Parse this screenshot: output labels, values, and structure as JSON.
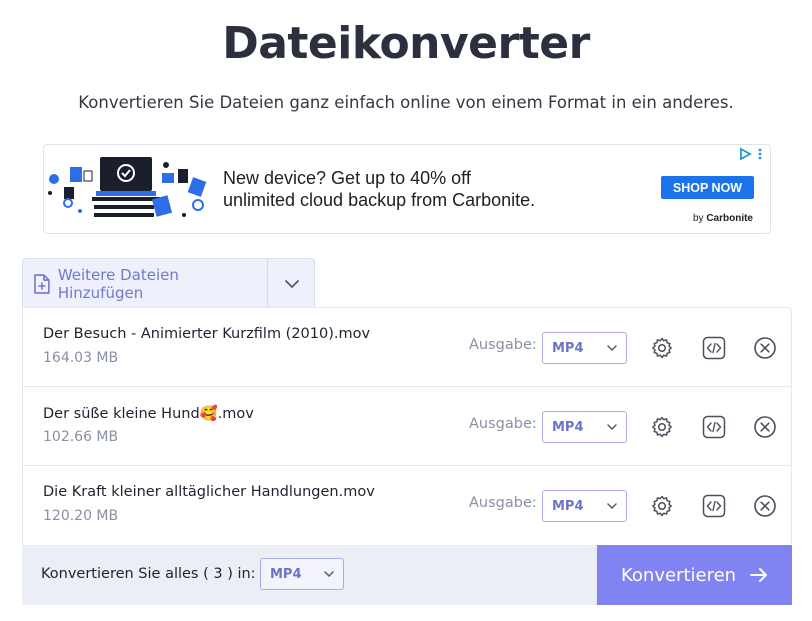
{
  "header": {
    "title": "Dateikonverter",
    "subtitle": "Konvertieren Sie Dateien ganz einfach online von einem Format in ein anderes."
  },
  "ad": {
    "line1": "New device? Get up to 40% off",
    "line2": "unlimited cloud backup from Carbonite.",
    "cta": "SHOP NOW",
    "by_prefix": "by",
    "by_brand": "Carbonite",
    "cta_color": "#1a73e8"
  },
  "add_files": {
    "label": "Weitere Dateien Hinzufügen"
  },
  "files": [
    {
      "name": "Der Besuch - Animierter Kurzfilm (2010).mov",
      "size": "164.03 MB",
      "output_label": "Ausgabe:",
      "format": "MP4"
    },
    {
      "name": "Der süße kleine Hund🥰.mov",
      "size": "102.66 MB",
      "output_label": "Ausgabe:",
      "format": "MP4"
    },
    {
      "name": "Die Kraft kleiner alltäglicher Handlungen.mov",
      "size": "120.20 MB",
      "output_label": "Ausgabe:",
      "format": "MP4"
    }
  ],
  "footer": {
    "convert_all_label": "Konvertieren Sie alles ( 3 ) in:",
    "format": "MP4",
    "convert_button": "Konvertieren"
  },
  "colors": {
    "accent": "#7f84f2",
    "accent_text": "#6d74c8",
    "title": "#2b2f3e"
  }
}
